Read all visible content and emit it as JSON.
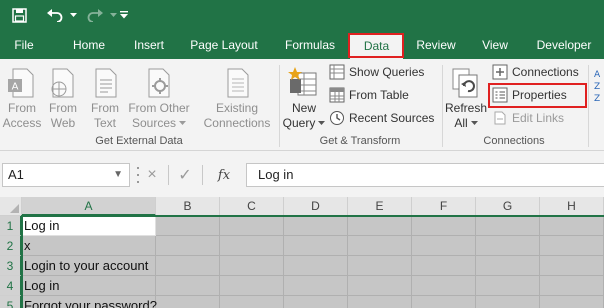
{
  "qat": {
    "save": "save-icon",
    "undo": "undo-icon",
    "redo": "redo-icon",
    "customize": "customize-qat-icon"
  },
  "tabs": [
    {
      "label": "File"
    },
    {
      "label": "Home"
    },
    {
      "label": "Insert"
    },
    {
      "label": "Page Layout"
    },
    {
      "label": "Formulas"
    },
    {
      "label": "Data",
      "active": true
    },
    {
      "label": "Review"
    },
    {
      "label": "View"
    },
    {
      "label": "Developer"
    }
  ],
  "ribbon": {
    "get_external_data": {
      "group_label": "Get External Data",
      "from_access": {
        "line1": "From",
        "line2": "Access"
      },
      "from_web": {
        "line1": "From",
        "line2": "Web"
      },
      "from_text": {
        "line1": "From",
        "line2": "Text"
      },
      "from_other": {
        "line1": "From Other",
        "line2": "Sources"
      },
      "existing": {
        "line1": "Existing",
        "line2": "Connections"
      }
    },
    "get_transform": {
      "group_label": "Get & Transform",
      "new_query": {
        "line1": "New",
        "line2": "Query"
      },
      "show_queries": "Show Queries",
      "from_table": "From Table",
      "recent_sources": "Recent Sources"
    },
    "connections": {
      "group_label": "Connections",
      "refresh_all": {
        "line1": "Refresh",
        "line2": "All"
      },
      "connections": "Connections",
      "properties": "Properties",
      "edit_links": "Edit Links"
    }
  },
  "formula_bar": {
    "name_box": "A1",
    "cancel": "×",
    "enter": "✓",
    "fx": "fx",
    "value": "Log in"
  },
  "columns": [
    "A",
    "B",
    "C",
    "D",
    "E",
    "F",
    "G",
    "H"
  ],
  "rows": [
    {
      "num": "1",
      "a": "Log in"
    },
    {
      "num": "2",
      "a": "x"
    },
    {
      "num": "3",
      "a": "Login to your account"
    },
    {
      "num": "4",
      "a": "Log in"
    },
    {
      "num": "5",
      "a": "Forgot your password?"
    }
  ],
  "colors": {
    "excel_green": "#217346",
    "highlight_red": "#e02020"
  }
}
